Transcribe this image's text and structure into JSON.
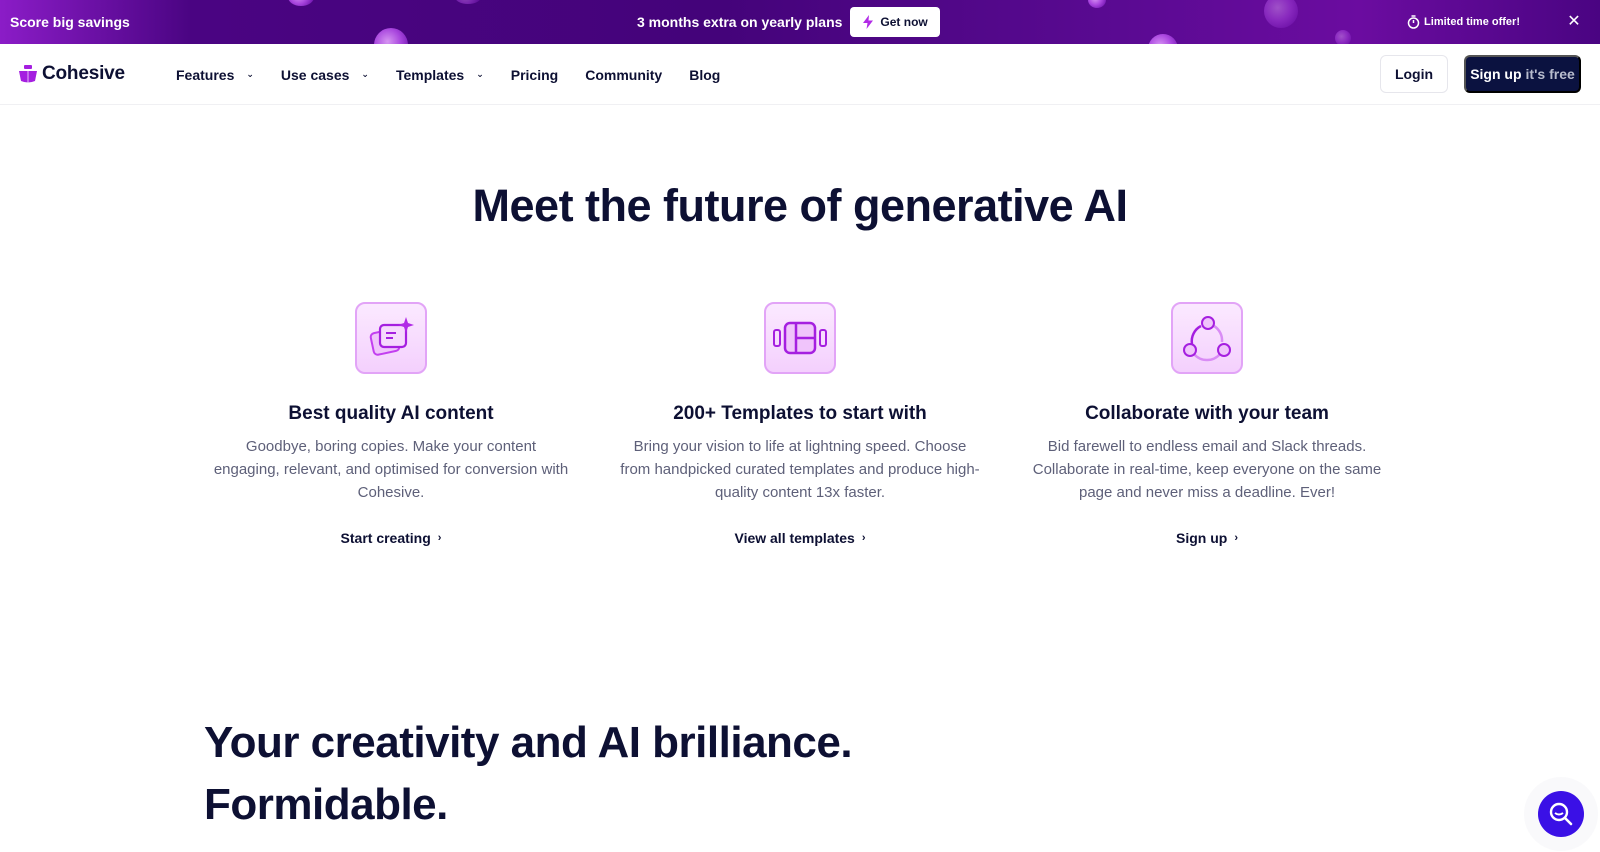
{
  "promo": {
    "left_text": "Score big savings",
    "center_text": "3 months extra on yearly plans",
    "cta_label": "Get now",
    "right_text": "Limited time offer!",
    "close_label": "✕"
  },
  "nav": {
    "brand": "Cohesive",
    "items": [
      {
        "label": "Features",
        "has_dropdown": true
      },
      {
        "label": "Use cases",
        "has_dropdown": true
      },
      {
        "label": "Templates",
        "has_dropdown": true
      },
      {
        "label": "Pricing",
        "has_dropdown": false
      },
      {
        "label": "Community",
        "has_dropdown": false
      },
      {
        "label": "Blog",
        "has_dropdown": false
      }
    ],
    "login_label": "Login",
    "signup_label": "Sign up",
    "signup_suffix": "it's free"
  },
  "hero": {
    "title": "Meet the future of generative AI"
  },
  "features": [
    {
      "icon": "content-cards-sparkle-icon",
      "title": "Best quality AI content",
      "description": "Goodbye, boring copies. Make your content engaging, relevant, and optimised for conversion with Cohesive.",
      "link_label": "Start creating"
    },
    {
      "icon": "templates-carousel-icon",
      "title": "200+ Templates to start with",
      "description": "Bring your vision to life at lightning speed. Choose from handpicked curated templates and produce high-quality content 13x faster.",
      "link_label": "View all templates"
    },
    {
      "icon": "collaboration-share-icon",
      "title": "Collaborate with your team",
      "description": "Bid farewell to endless email and Slack threads. Collaborate in real-time, keep everyone on the same page and never miss a deadline. Ever!",
      "link_label": "Sign up"
    }
  ],
  "section2": {
    "title_line1": "Your creativity and AI brilliance.",
    "title_line2": "Formidable."
  },
  "colors": {
    "brand_purple": "#a51fe0",
    "navy": "#0b1240",
    "banner_purple": "#44037a",
    "chat_blue": "#3a10e6"
  }
}
